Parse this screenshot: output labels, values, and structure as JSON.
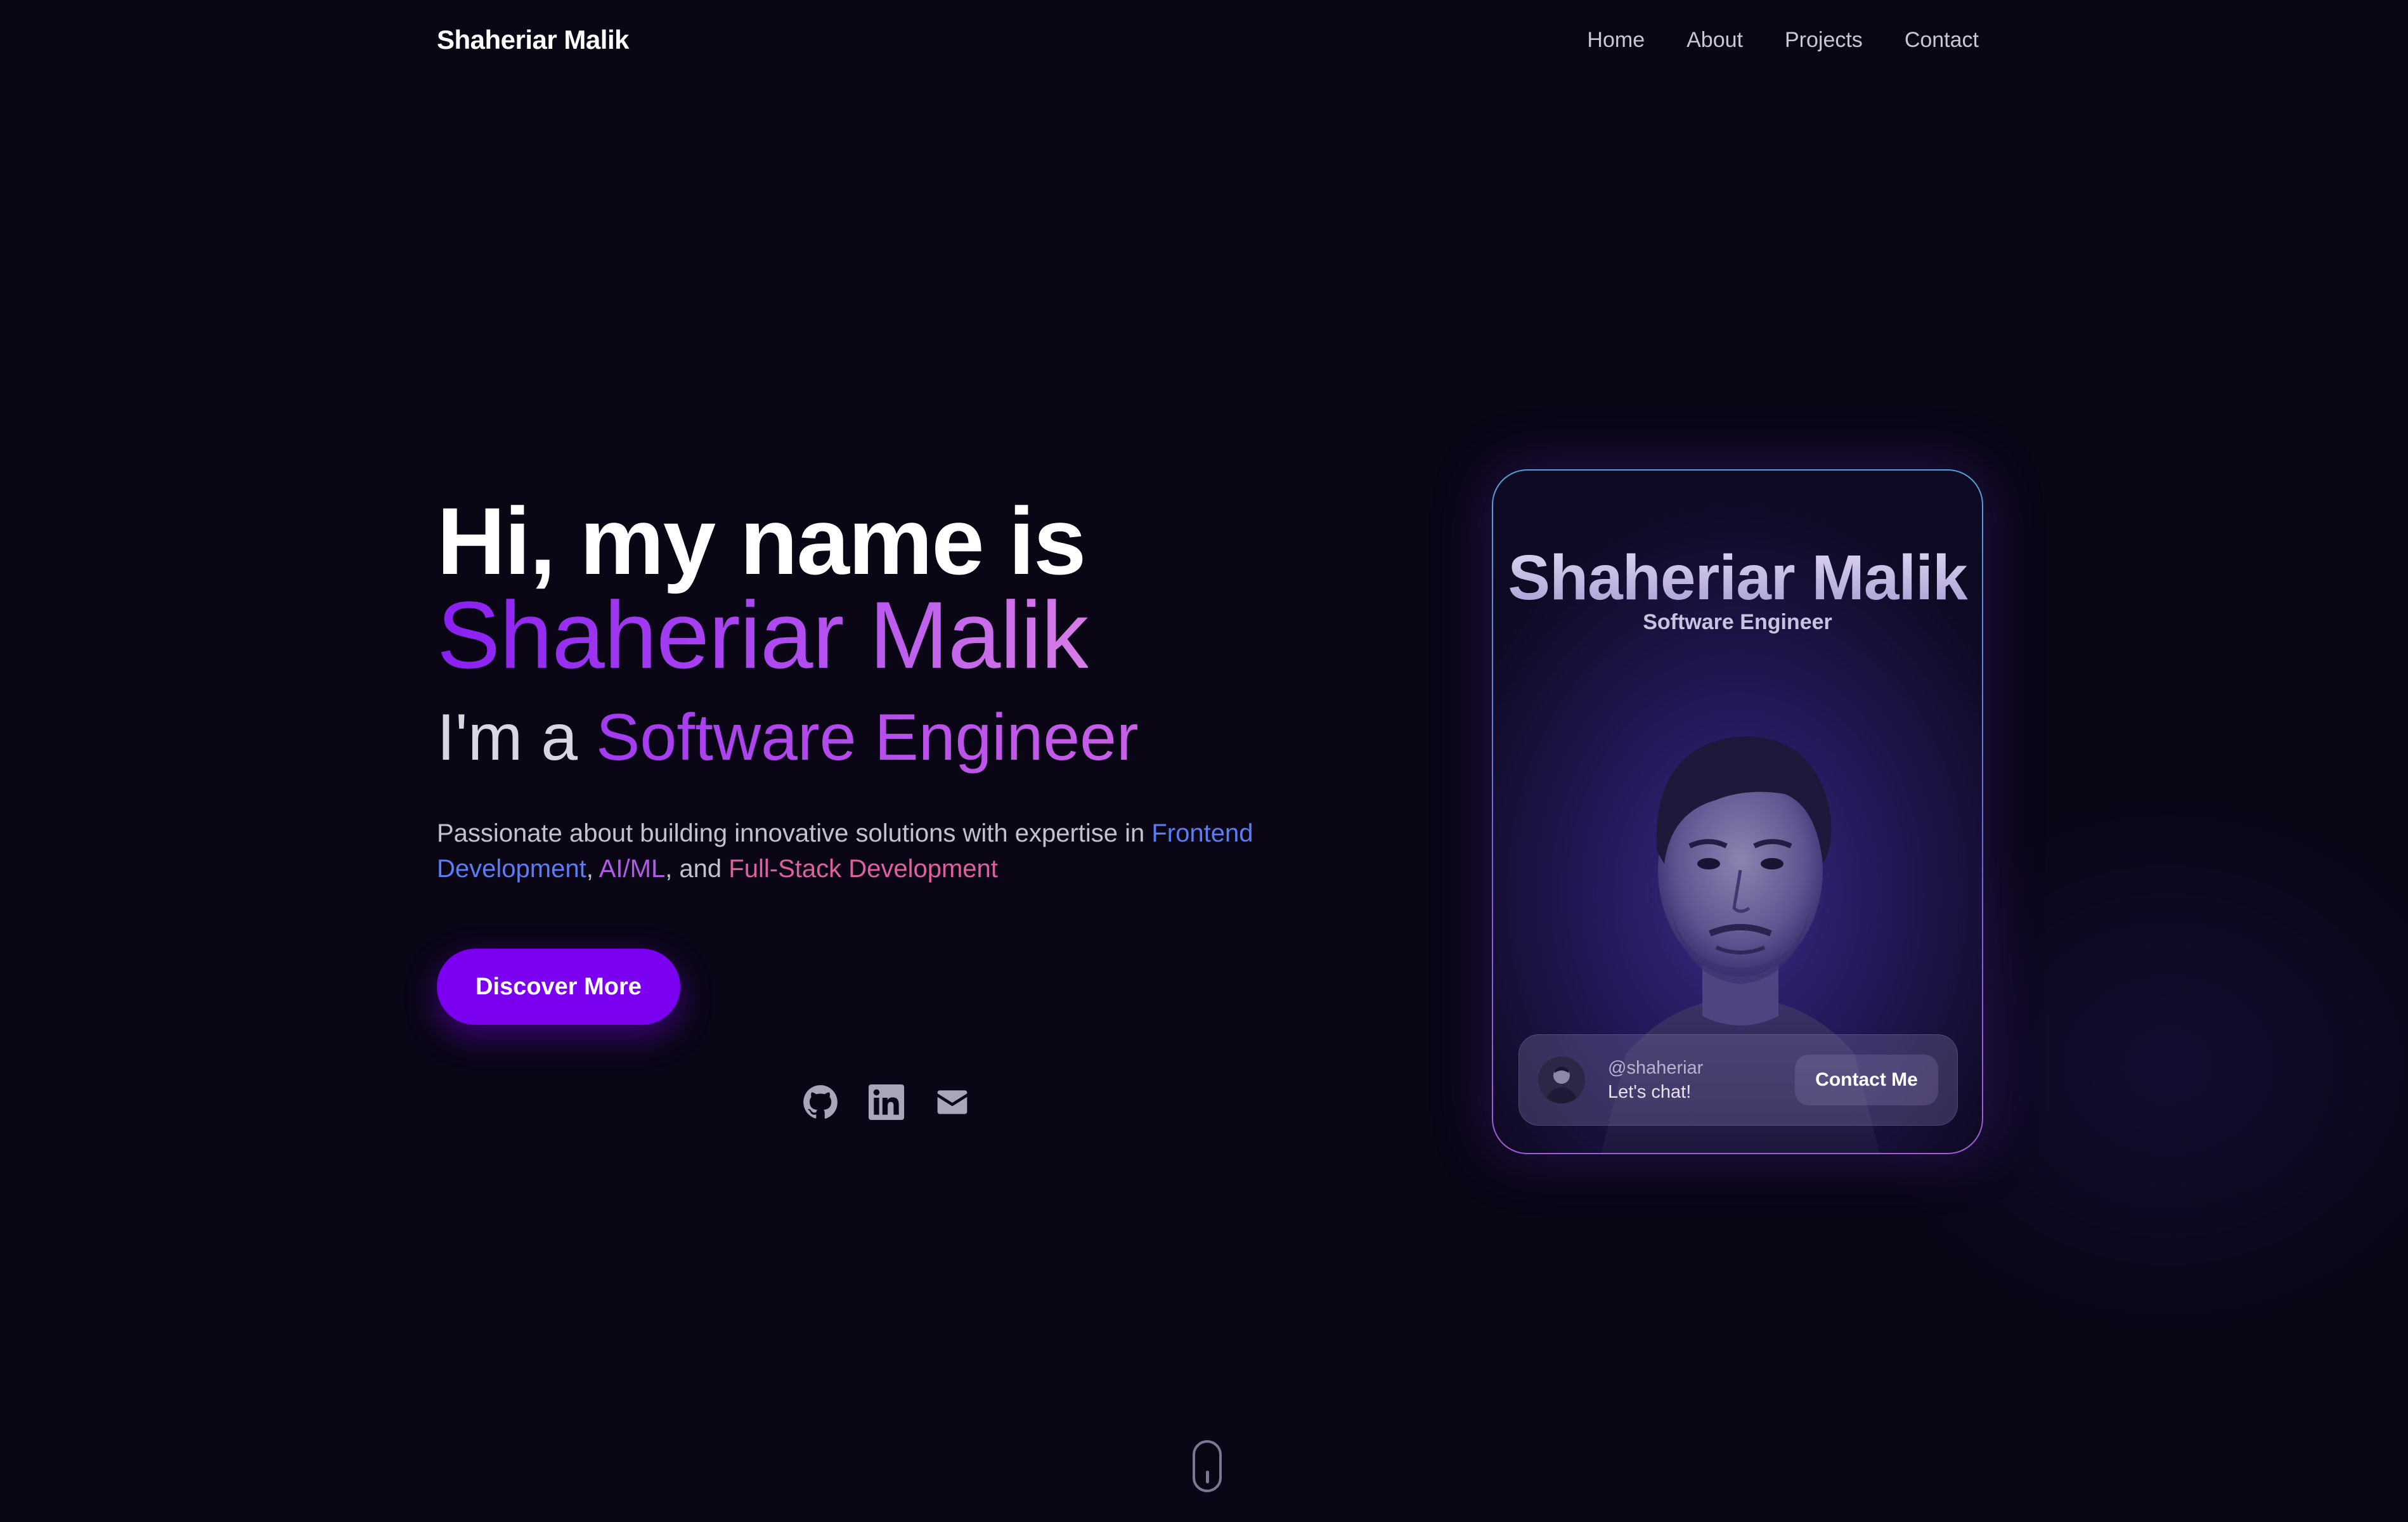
{
  "nav": {
    "brand": "Shaheriar Malik",
    "links": [
      "Home",
      "About",
      "Projects",
      "Contact"
    ]
  },
  "hero": {
    "greeting": "Hi, my name is",
    "name": "Shaheriar Malik",
    "role_prefix": "I'm a",
    "role": "Software Engineer",
    "description": {
      "lead": "Passionate about building innovative solutions with expertise in",
      "skill1": "Frontend Development",
      "sep1": ",",
      "skill2": "AI/ML",
      "sep2": ", and",
      "skill3": "Full-Stack Development"
    },
    "cta_label": "Discover More"
  },
  "socials": [
    {
      "icon": "github-icon"
    },
    {
      "icon": "linkedin-icon"
    },
    {
      "icon": "mail-icon"
    }
  ],
  "card": {
    "title": "Shaheriar Malik",
    "subtitle": "Software Engineer",
    "handle": "@shaheriar",
    "message": "Let's chat!",
    "contact_label": "Contact Me"
  },
  "colors": {
    "background": "#0a0616",
    "accent": "#7b00f0",
    "skill_blue": "#5b7cf2",
    "skill_purple": "#b05ce8",
    "skill_pink": "#e0609e"
  }
}
